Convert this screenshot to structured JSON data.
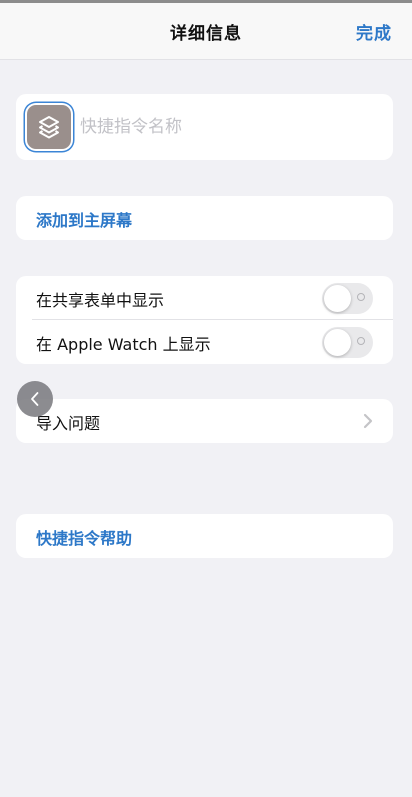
{
  "navbar": {
    "title": "详细信息",
    "done_label": "完成"
  },
  "shortcut": {
    "icon": "shortcuts-layers-icon",
    "icon_color": "#9a8f8c",
    "name_value": "",
    "name_placeholder": "快捷指令名称"
  },
  "add_to_home": {
    "label": "添加到主屏幕"
  },
  "toggles": [
    {
      "label": "在共享表单中显示",
      "on": false
    },
    {
      "label": "在 Apple Watch 上显示",
      "on": false
    }
  ],
  "import_questions": {
    "label": "导入问题"
  },
  "help": {
    "label": "快捷指令帮助"
  },
  "colors": {
    "accent": "#2d78c8",
    "background": "#f1f1f5",
    "card": "#ffffff"
  }
}
